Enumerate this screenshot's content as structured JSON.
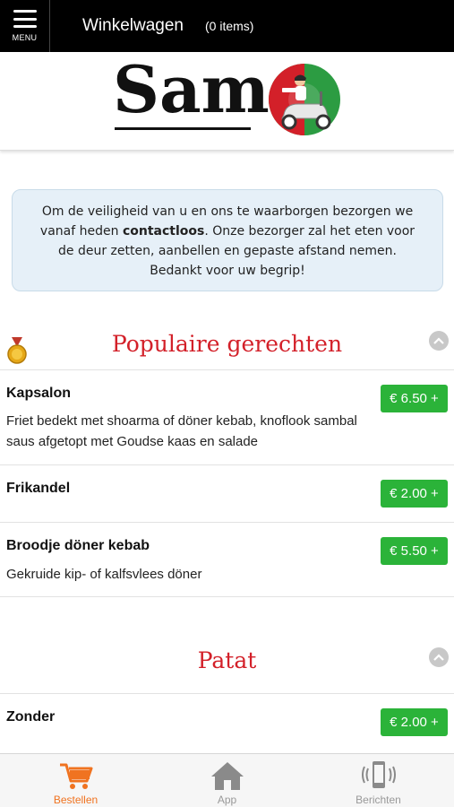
{
  "header": {
    "menu_label": "MENU",
    "cart_title": "Winkelwagen",
    "cart_count": "(0 items)"
  },
  "logo": {
    "text": "Sam"
  },
  "notice": {
    "text_before": "Om de veiligheid van u en ons te waarborgen bezorgen we vanaf heden ",
    "text_bold": "contactloos",
    "text_after": ". Onze bezorger zal het eten voor de deur zetten, aanbellen en gepaste afstand nemen. Bedankt voor uw begrip!"
  },
  "sections": [
    {
      "title": "Populaire gerechten",
      "items": [
        {
          "name": "Kapsalon",
          "description": "Friet bedekt met shoarma of döner kebab, knoflook sambal saus afgetopt met Goudse kaas en salade",
          "price": "€ 6.50 +"
        },
        {
          "name": "Frikandel",
          "description": "",
          "price": "€ 2.00 +"
        },
        {
          "name": "Broodje döner kebab",
          "description": "Gekruide kip- of kalfsvlees döner",
          "price": "€ 5.50 +"
        }
      ]
    },
    {
      "title": "Patat",
      "items": [
        {
          "name": "Zonder",
          "description": "",
          "price": "€ 2.00 +"
        }
      ]
    }
  ],
  "bottom_nav": [
    {
      "label": "Bestellen",
      "icon": "cart-icon",
      "active": true
    },
    {
      "label": "App",
      "icon": "home-icon",
      "active": false
    },
    {
      "label": "Berichten",
      "icon": "phone-vibrate-icon",
      "active": false
    }
  ],
  "colors": {
    "accent_red": "#d32029",
    "price_green": "#2bb339",
    "nav_active": "#f07320"
  }
}
